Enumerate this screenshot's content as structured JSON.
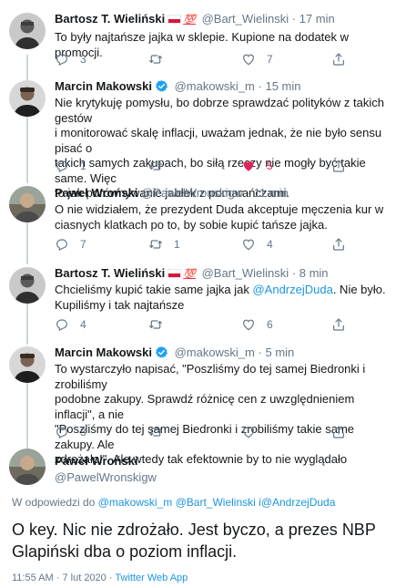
{
  "tweets": [
    {
      "name": "Bartosz T. Wieliński",
      "badge": "💯",
      "handle": "@Bart_Wielinski",
      "time": "17 min",
      "lines": [
        "To były najtańsze jajka w sklepie. Kupione na dodatek w promocji."
      ],
      "replies": "3",
      "retweets": "",
      "likes": "7",
      "liked": false
    },
    {
      "name": "Marcin Makowski",
      "handle": "@makowski_m",
      "time": "15 min",
      "lines": [
        "Nie krytykuję pomysłu, bo dobrze sprawdzać polityków z takich gestów",
        "i monitorować skalę inflacji, uważam jednak, że nie było sensu pisać o",
        "takich samych zakupach, bo siłą rzeczy nie mogły być takie same. Więc",
        "to jak porównywanie jabłek z pomarańczami."
      ],
      "replies": "1",
      "retweets": "",
      "likes": "5",
      "liked": true
    },
    {
      "name": "Paweł Wroński",
      "handle": "@PawelWronskigw",
      "time": "11 min",
      "lines": [
        "O nie widziałem, że prezydent Duda akceptuje męczenia kur w",
        "ciasnych klatkach po to, by sobie kupić tańsze jajka."
      ],
      "replies": "7",
      "retweets": "1",
      "likes": "4",
      "liked": false
    },
    {
      "name": "Bartosz T. Wieliński",
      "badge": "💯",
      "handle": "@Bart_Wielinski",
      "time": "8 min",
      "line1_before": "Chcieliśmy kupić takie same jajka jak ",
      "line1_mention": "@AndrzejDuda",
      "line1_after": ". Nie było.",
      "line2": "Kupiliśmy i tak najtańsze",
      "replies": "4",
      "retweets": "",
      "likes": "6",
      "liked": false
    },
    {
      "name": "Marcin Makowski",
      "handle": "@makowski_m",
      "time": "5 min",
      "lines": [
        "To wystarczyło napisać, \"Poszliśmy do tej samej Biedronki i zrobiliśmy",
        "podobne zakupy. Sprawdź różnicę cen z uwzględnieniem inflacji\", a nie",
        "\"Poszliśmy do tej samej Biedronki i zrobiliśmy takie same zakupy. Ale",
        "zdrożało!\". Ale wtedy tak efektownie by to nie wyglądało"
      ],
      "replies": "3",
      "retweets": "",
      "likes": "",
      "liked": false
    }
  ],
  "main": {
    "name": "Paweł Wroński",
    "handle": "@PawelWronskigw",
    "reply_prefix": "W odpowiedzi do",
    "reply_handles": [
      "@makowski_m",
      "@Bart_Wielinski",
      "i@AndrzejDuda"
    ],
    "text_line1": "O key. Nic nie zdrożało. Jest byczo, a prezes NBP",
    "text_line2": "Glapiński dba o poziom inflacji.",
    "time": "11:55 AM",
    "date": "7 lut 2020",
    "separator": "·",
    "app": "Twitter Web App"
  },
  "ui": {
    "dot": "·",
    "accent_color": "#1b95e0",
    "like_color": "#e0245e",
    "icons": [
      "reply-icon",
      "retweet-icon",
      "like-icon",
      "share-icon",
      "verified-icon",
      "flag-icon"
    ]
  }
}
